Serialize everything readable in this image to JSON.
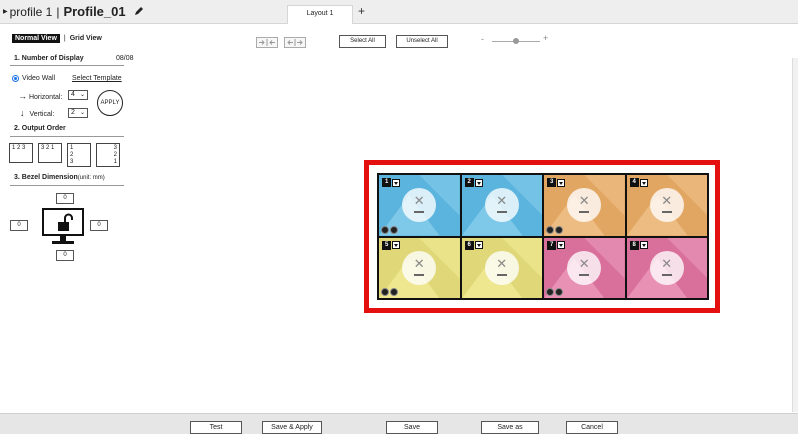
{
  "header": {
    "profile_label": "profile 1",
    "separator": "|",
    "profile_name": "Profile_01",
    "tabs": [
      {
        "label": "Layout 1"
      }
    ],
    "add_tab": "+"
  },
  "left_panel": {
    "views": {
      "normal": "Normal View",
      "separator": "|",
      "grid": "Grid View"
    },
    "number_of_display": {
      "title": "1.  Number of Display",
      "count": "08/08"
    },
    "mode": {
      "label": "Video Wall",
      "selected": true,
      "template_link": "Select Template"
    },
    "horizontal": {
      "label": "Horizontal:",
      "value": "4"
    },
    "vertical": {
      "label": "Vertical:",
      "value": "2"
    },
    "apply_label": "APPLY",
    "output_order": {
      "title": "2.  Output Order",
      "options": [
        "1 2 3",
        "3 2 1",
        "1\n2\n3",
        "3\n2\n1"
      ]
    },
    "bezel": {
      "title": "3.  Bezel Dimension",
      "unit": "(unit: mm)",
      "top": "0",
      "left": "0",
      "right": "0",
      "bottom": "0"
    }
  },
  "toolbar": {
    "select_all": "Select All",
    "unselect_all": "Unselect All",
    "zoom_minus": "-",
    "zoom_plus": "+"
  },
  "wall": {
    "rows": 2,
    "cols": 4,
    "cells": [
      {
        "number": "1",
        "color": "#5ab4dd",
        "accent": "#8dd0ee"
      },
      {
        "number": "2",
        "color": "#5ab4dd",
        "accent": "#8dd0ee"
      },
      {
        "number": "3",
        "color": "#e2a663",
        "accent": "#f2c690"
      },
      {
        "number": "4",
        "color": "#e2a663",
        "accent": "#f2c690"
      },
      {
        "number": "5",
        "color": "#e0d878",
        "accent": "#f3ee9a"
      },
      {
        "number": "6",
        "color": "#e0d878",
        "accent": "#f3ee9a"
      },
      {
        "number": "7",
        "color": "#d9709c",
        "accent": "#ee9fc0"
      },
      {
        "number": "8",
        "color": "#d9709c",
        "accent": "#ee9fc0"
      }
    ],
    "highlight_color": "#e41010"
  },
  "footer": {
    "buttons": [
      "Test",
      "Save & Apply",
      "Save",
      "Save as",
      "Cancel"
    ]
  }
}
